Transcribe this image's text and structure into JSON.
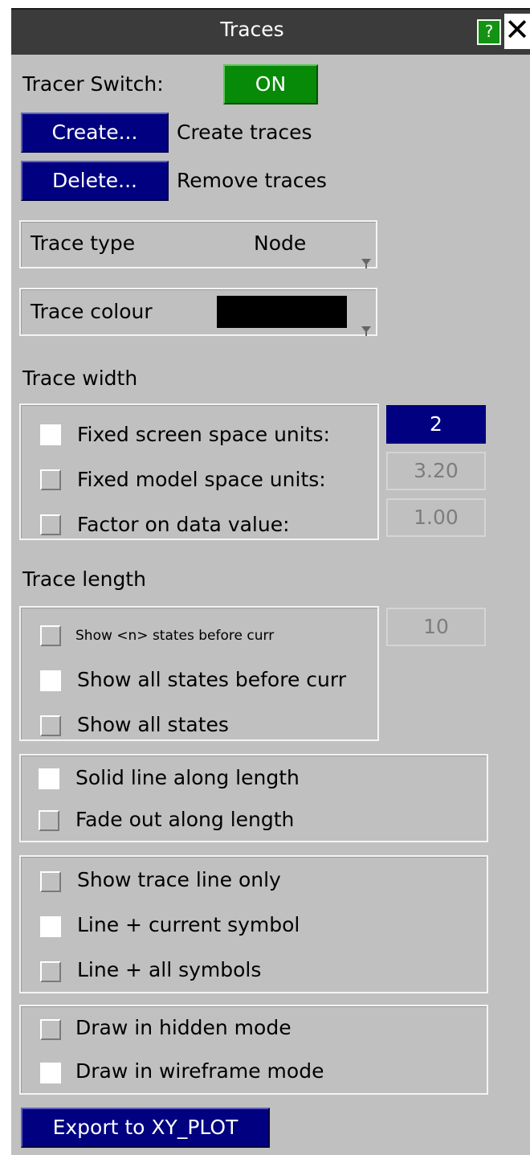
{
  "window": {
    "title": "Traces",
    "help_label": "?",
    "close_label": "✕"
  },
  "tracer": {
    "label": "Tracer Switch:",
    "value": "ON"
  },
  "actions": {
    "create_label": "Create...",
    "create_desc": "Create traces",
    "delete_label": "Delete...",
    "delete_desc": "Remove traces"
  },
  "trace_type": {
    "label": "Trace type",
    "value": "Node"
  },
  "trace_colour": {
    "label": "Trace colour",
    "color": "#000000"
  },
  "trace_width": {
    "heading": "Trace width",
    "options": [
      {
        "label": "Fixed screen space units:",
        "value": "2",
        "checked": true
      },
      {
        "label": "Fixed model space units:",
        "value": "3.20",
        "checked": false
      },
      {
        "label": "Factor on data value:",
        "value": "1.00",
        "checked": false
      }
    ]
  },
  "trace_length": {
    "heading": "Trace length",
    "options": [
      {
        "label": "Show <n> states before curr",
        "value": "10",
        "checked": false
      },
      {
        "label": "Show all states before curr",
        "checked": true
      },
      {
        "label": "Show all states",
        "checked": false
      }
    ]
  },
  "line_style": {
    "options": [
      {
        "label": "Solid line along length",
        "checked": true
      },
      {
        "label": "Fade out along length",
        "checked": false
      }
    ]
  },
  "symbols": {
    "options": [
      {
        "label": "Show trace line only",
        "checked": false
      },
      {
        "label": "Line + current symbol",
        "checked": true
      },
      {
        "label": "Line + all symbols",
        "checked": false
      }
    ]
  },
  "draw_mode": {
    "options": [
      {
        "label": "Draw in hidden mode",
        "checked": false
      },
      {
        "label": "Draw in wireframe mode",
        "checked": true
      }
    ]
  },
  "export": {
    "label": "Export to XY_PLOT"
  },
  "colors": {
    "panel": "#c0c0c0",
    "titlebar": "#3b3b3b",
    "button_blue": "#000080",
    "button_green": "#078a07"
  }
}
